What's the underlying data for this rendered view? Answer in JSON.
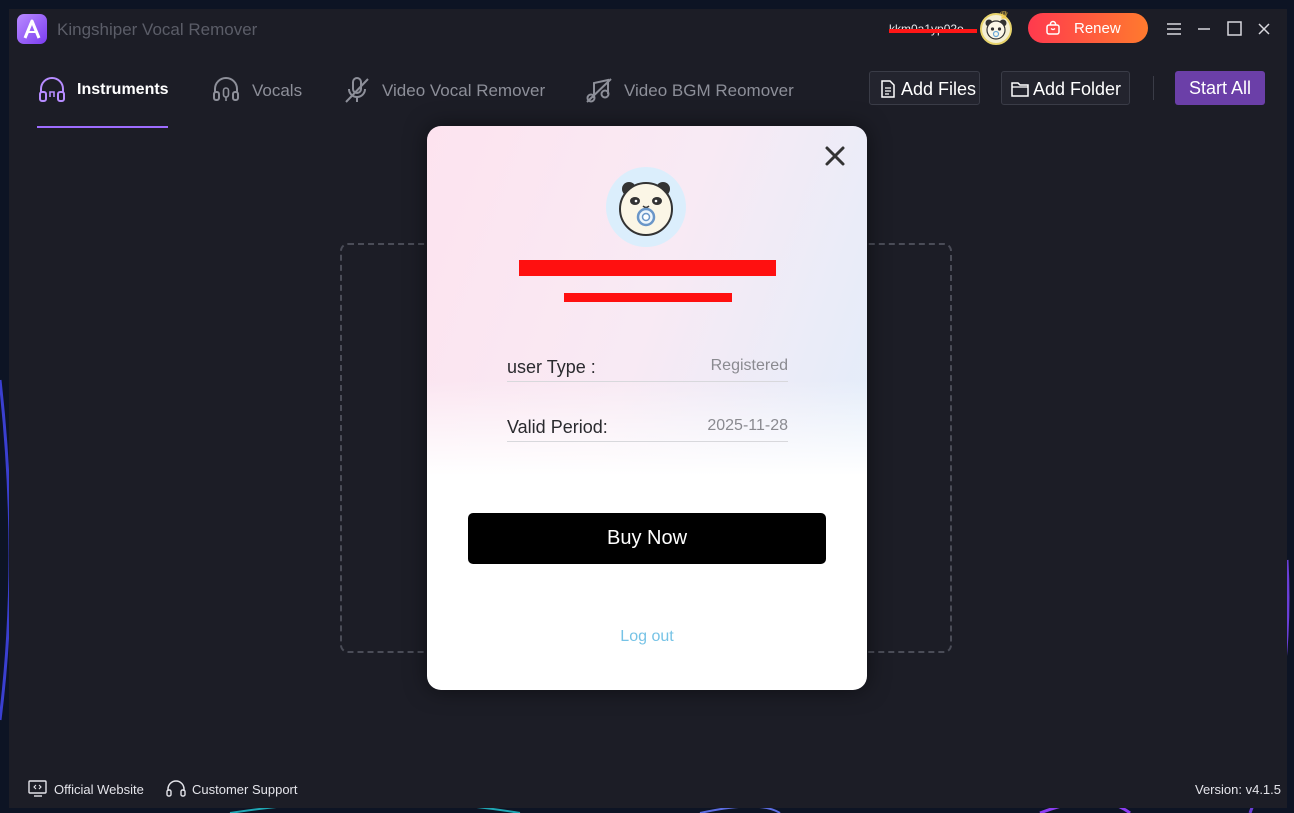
{
  "window": {
    "app_title": "Kingshiper Vocal Remover",
    "user_name": "kkm0a1yp02o..."
  },
  "header": {
    "renew_label": "Renew"
  },
  "tabs": [
    {
      "label": "Instruments",
      "active": true,
      "icon": "headphones-icon"
    },
    {
      "label": "Vocals",
      "active": false,
      "icon": "headset-mic-icon"
    },
    {
      "label": "Video Vocal Remover",
      "active": false,
      "icon": "mic-off-icon"
    },
    {
      "label": "Video BGM Reomover",
      "active": false,
      "icon": "music-off-icon"
    }
  ],
  "toolbar": {
    "add_files_label": "Add Files",
    "add_folder_label": "Add Folder",
    "start_all_label": "Start All"
  },
  "account_modal": {
    "rows": [
      {
        "label": "user Type :",
        "value": "Registered"
      },
      {
        "label": "Valid Period:",
        "value": "2025-11-28"
      }
    ],
    "buy_label": "Buy Now",
    "logout_label": "Log out"
  },
  "footer": {
    "website_label": "Official Website",
    "support_label": "Customer Support",
    "version_label": "Version: v4.1.5"
  },
  "colors": {
    "accent": "#9d6cff",
    "start_button": "#6b3fa8",
    "renew_gradient_start": "#ff3a4e",
    "renew_gradient_end": "#ff7a2e",
    "app_background": "#1c1d26",
    "logout_link": "#76c3e6"
  }
}
